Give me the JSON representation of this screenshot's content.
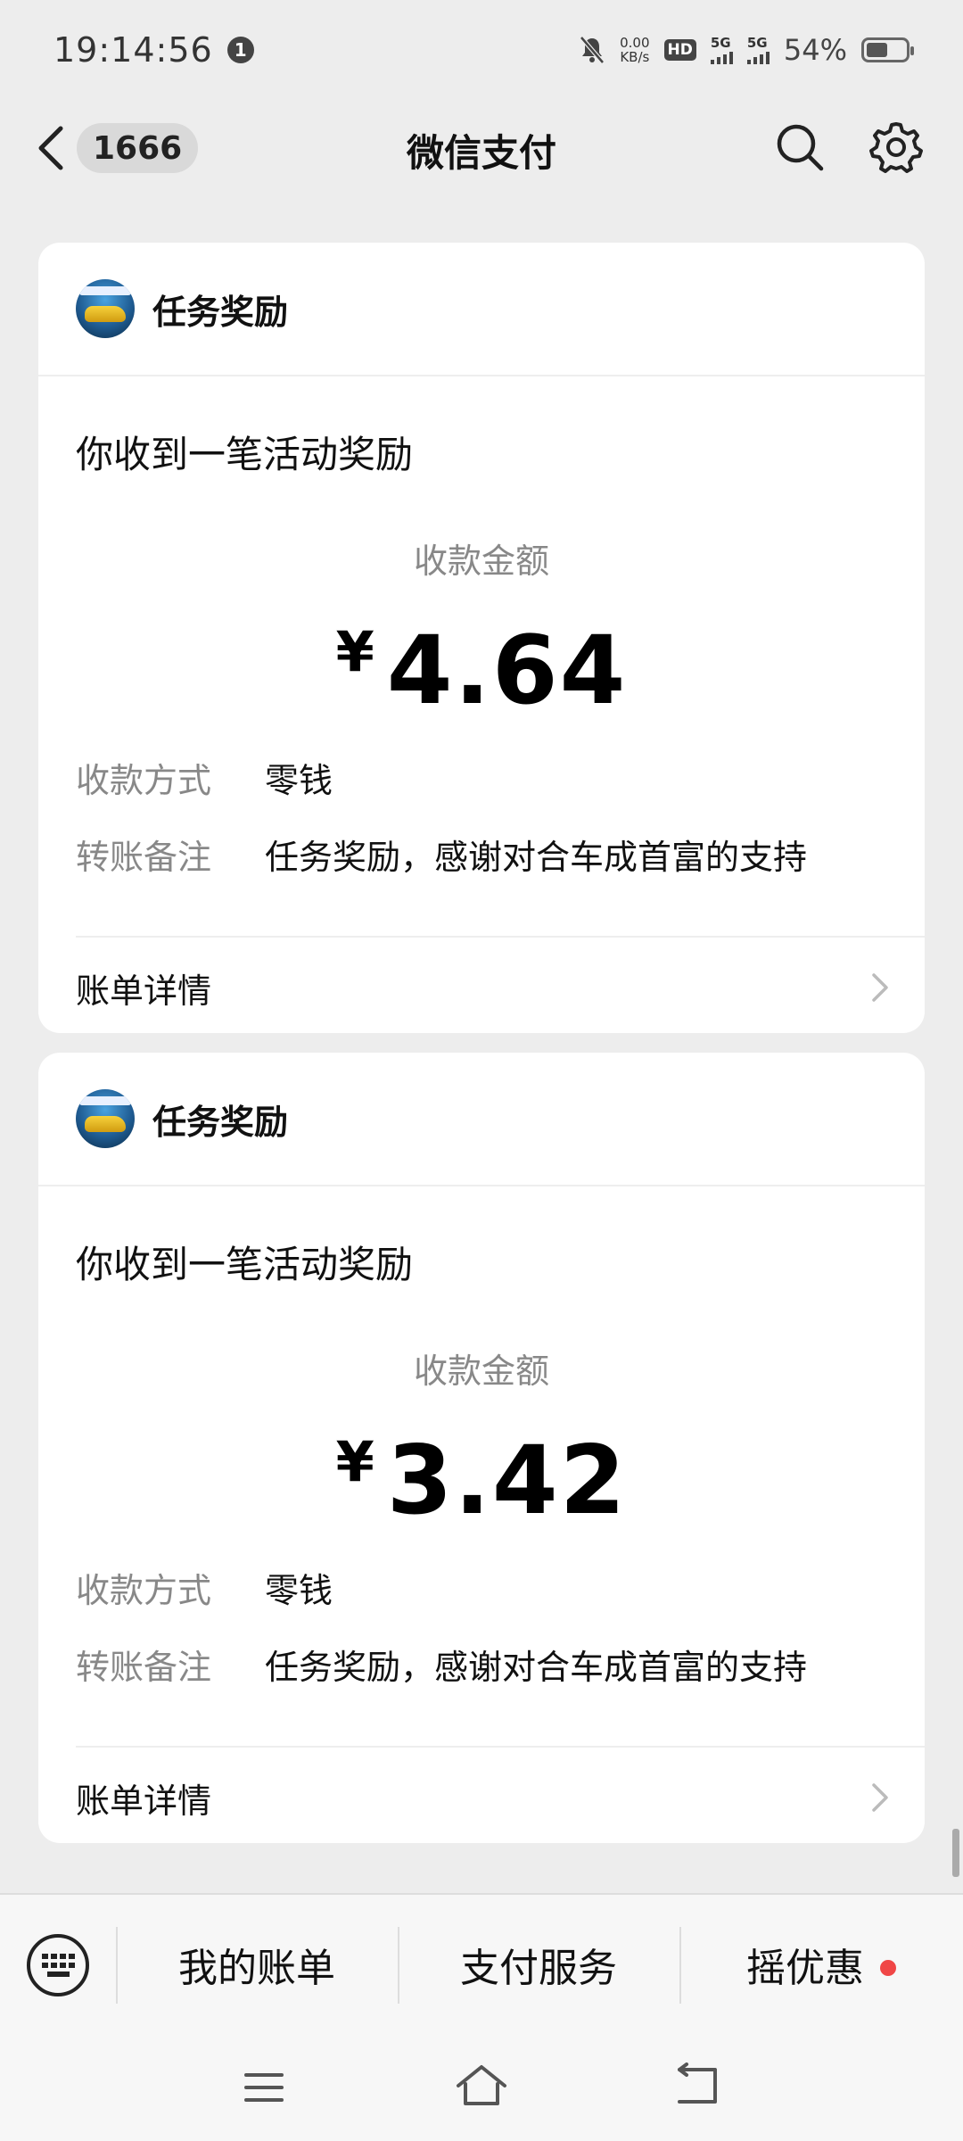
{
  "status_bar": {
    "time": "19:14:56",
    "notification_count": "1",
    "net_speed_top": "0.00",
    "net_speed_bottom": "KB/s",
    "hd_label": "HD",
    "sim1": "5G",
    "sim2": "5G",
    "battery": "54%",
    "battery_level": 0.54
  },
  "nav": {
    "back_badge": "1666",
    "title": "微信支付"
  },
  "cards": [
    {
      "source": "任务奖励",
      "headline": "你收到一笔活动奖励",
      "amount_label": "收款金额",
      "currency": "¥",
      "amount": "4.64",
      "method_key": "收款方式",
      "method_value": "零钱",
      "note_key": "转账备注",
      "note_value": "任务奖励，感谢对合车成首富的支持",
      "detail_label": "账单详情"
    },
    {
      "source": "任务奖励",
      "headline": "你收到一笔活动奖励",
      "amount_label": "收款金额",
      "currency": "¥",
      "amount": "3.42",
      "method_key": "收款方式",
      "method_value": "零钱",
      "note_key": "转账备注",
      "note_value": "任务奖励，感谢对合车成首富的支持",
      "detail_label": "账单详情"
    }
  ],
  "bottom_bar": {
    "items": [
      "我的账单",
      "支付服务",
      "摇优惠"
    ],
    "accent_dot_color": "#f04646"
  }
}
